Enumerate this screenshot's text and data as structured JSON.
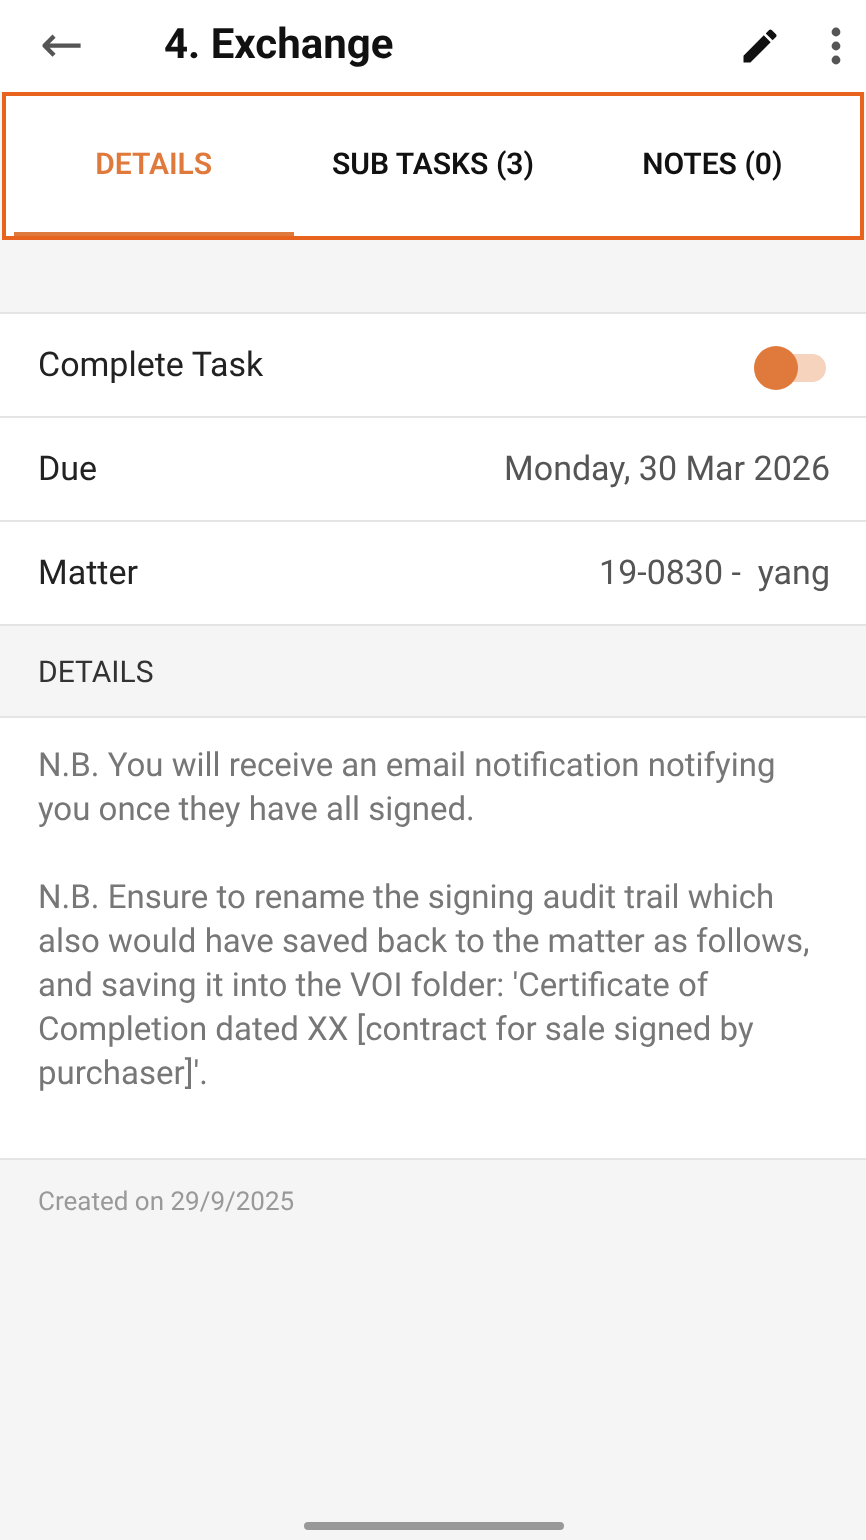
{
  "header": {
    "back": "←",
    "title": "4. Exchange"
  },
  "tabs": [
    {
      "label": "DETAILS",
      "selected": true
    },
    {
      "label": "SUB TASKS (3)",
      "selected": false
    },
    {
      "label": "NOTES (0)",
      "selected": false
    }
  ],
  "rows": [
    {
      "kind": "toggle",
      "label": "Complete Task",
      "on": false
    },
    {
      "kind": "value",
      "label": "Due",
      "value": "Monday, 30 Mar 2026"
    },
    {
      "kind": "value",
      "label": "Matter",
      "value": "19-0830 -  yang"
    }
  ],
  "section": {
    "title": "DETAILS"
  },
  "details": [
    "N.B. You will receive an email notification notifying you once they have all signed.",
    "N.B. Ensure to rename the signing audit trail which also would have saved back to the matter as follows, and saving it into the VOI folder: 'Certificate of Completion dated XX [contract for sale signed by purchaser]'."
  ],
  "footer": {
    "created": "Created on 29/9/2025"
  }
}
